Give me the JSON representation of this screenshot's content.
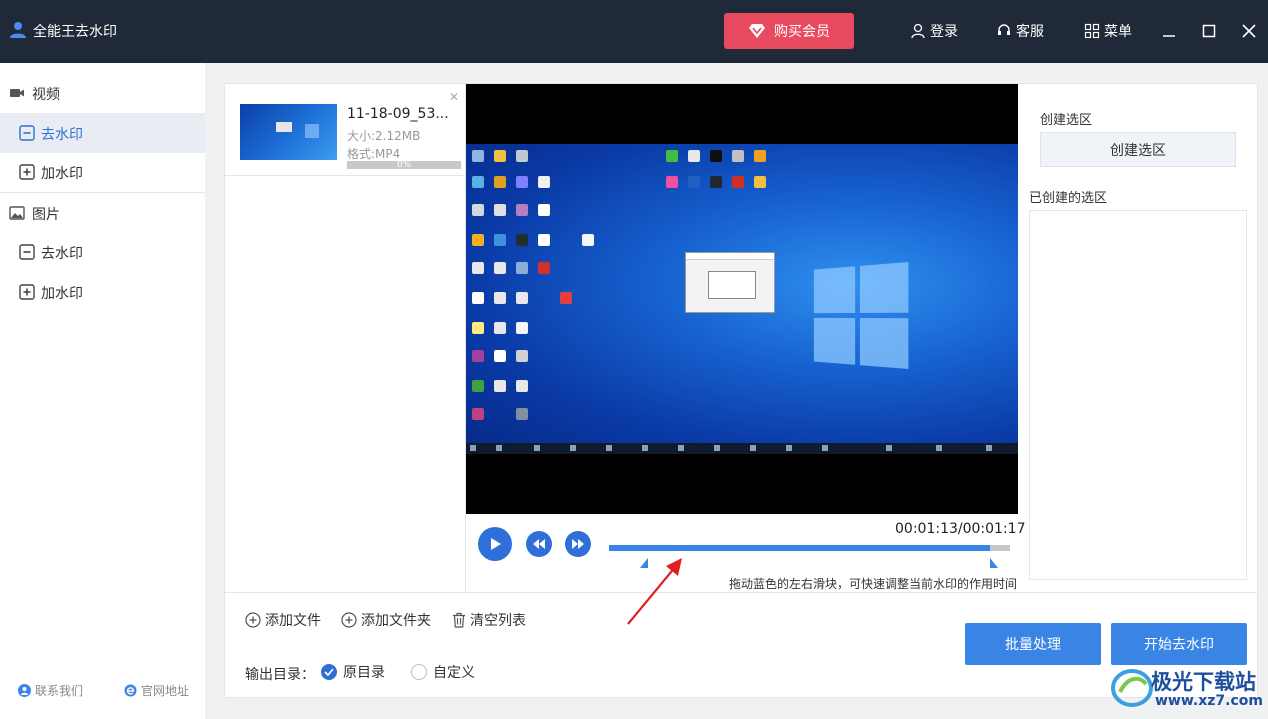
{
  "app": {
    "title": "全能王去水印",
    "vip_label": "购买会员",
    "login_label": "登录",
    "service_label": "客服",
    "menu_label": "菜单"
  },
  "colors": {
    "titlebar": "#1f2937",
    "accent": "#2e6fd8",
    "vip": "#e84a5f",
    "primary": "#3a84e6"
  },
  "sidebar": {
    "video": {
      "label": "视频",
      "items": [
        {
          "label": "去水印",
          "active": true
        },
        {
          "label": "加水印",
          "active": false
        }
      ]
    },
    "image": {
      "label": "图片",
      "items": [
        {
          "label": "去水印",
          "active": false
        },
        {
          "label": "加水印",
          "active": false
        }
      ]
    },
    "footer": {
      "contact": "联系我们",
      "website": "官网地址"
    }
  },
  "file": {
    "name": "11-18-09_53...",
    "size": "大小:2.12MB",
    "format": "格式:MP4",
    "progress_label": "0%",
    "progress": 0
  },
  "player": {
    "current_time": "00:01:13",
    "separator": "/",
    "total_time": "00:01:17",
    "progress": 0.95,
    "hint": "拖动蓝色的左右滑块，可快速调整当前水印的作用时间"
  },
  "region": {
    "title": "创建选区",
    "button": "创建选区",
    "created_title": "已创建的选区"
  },
  "toolbar": {
    "add_file": "添加文件",
    "add_folder": "添加文件夹",
    "clear_list": "清空列表",
    "output_label": "输出目录：",
    "opt_original": "原目录",
    "opt_custom": "自定义",
    "selected_output": "原目录"
  },
  "actions": {
    "batch": "批量处理",
    "start": "开始去水印"
  },
  "watermark": {
    "title": "极光下载站",
    "url": "www.xz7.com"
  }
}
